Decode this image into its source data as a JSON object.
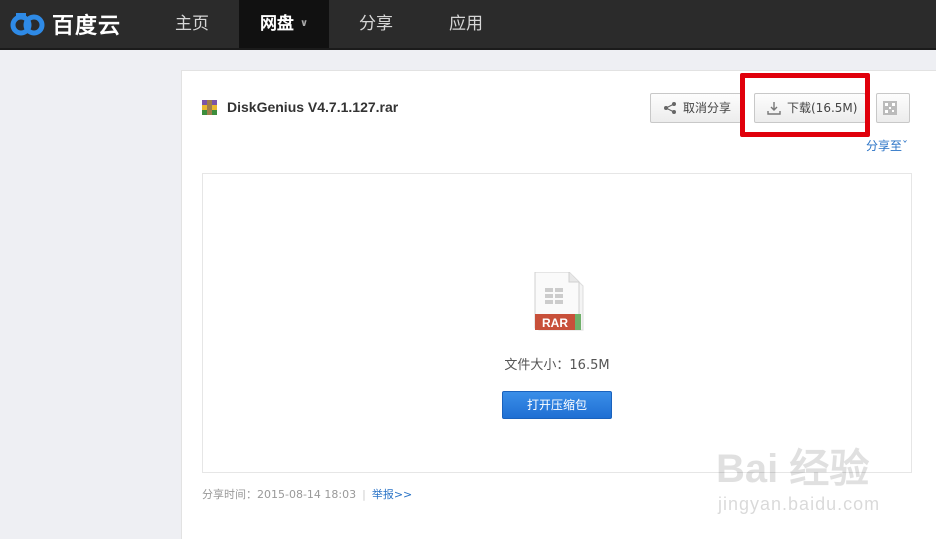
{
  "nav": {
    "brand": "百度云",
    "items": [
      {
        "label": "主页"
      },
      {
        "label": "网盘"
      },
      {
        "label": "分享"
      },
      {
        "label": "应用"
      }
    ]
  },
  "file": {
    "name": "DiskGenius V4.7.1.127.rar",
    "type_badge": "RAR",
    "size_text": "文件大小：16.5M"
  },
  "actions": {
    "cancel_share": "取消分享",
    "download": "下载(16.5M)",
    "share_to": "分享至",
    "open_archive": "打开压缩包"
  },
  "footer": {
    "share_time": "分享时间：2015-08-14 18:03",
    "report": "举报>>"
  },
  "watermark": {
    "brand": "Bai 经验",
    "url": "jingyan.baidu.com"
  },
  "colors": {
    "nav_bg": "#2b2b2b",
    "accent_blue": "#2a73c6",
    "highlight_red": "#e0000b"
  }
}
